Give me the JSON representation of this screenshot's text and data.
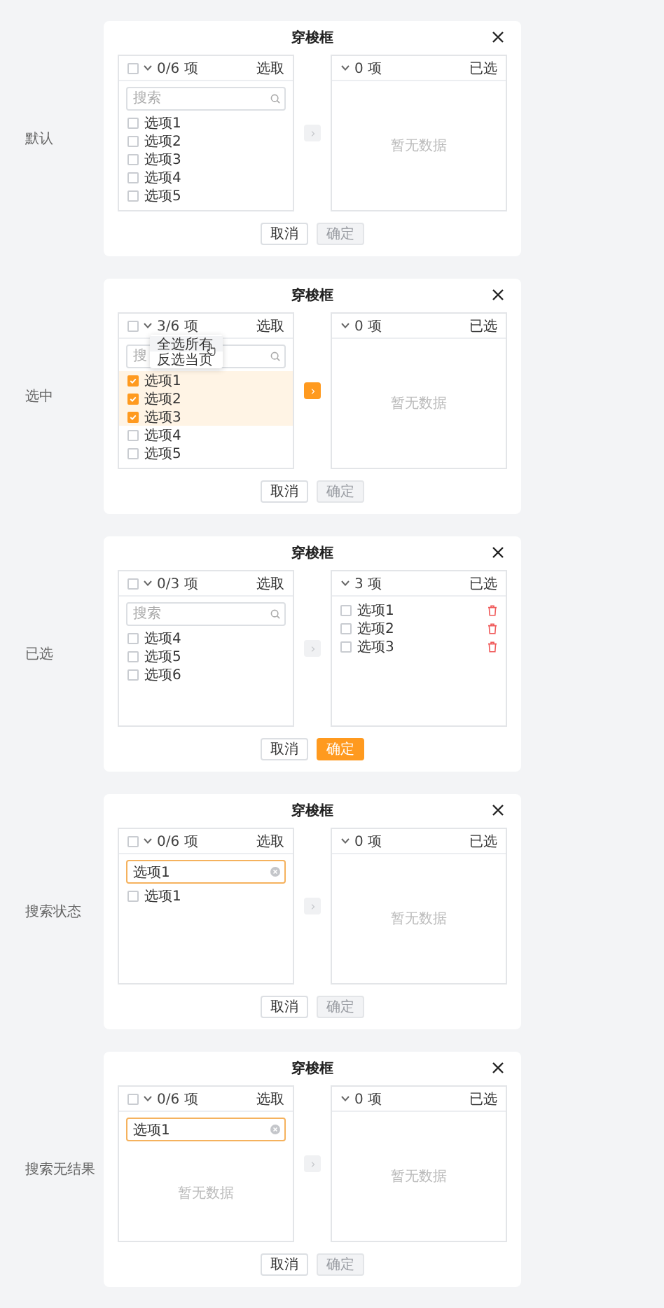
{
  "demos": [
    {
      "label": "默认",
      "title": "穿梭框",
      "left": {
        "checked": false,
        "count": "0/6 项",
        "label": "选取",
        "search": {
          "placeholder": "搜索",
          "focused": false
        },
        "items": [
          {
            "label": "选项1",
            "checked": false
          },
          {
            "label": "选项2",
            "checked": false
          },
          {
            "label": "选项3",
            "checked": false
          },
          {
            "label": "选项4",
            "checked": false
          },
          {
            "label": "选项5",
            "checked": false
          }
        ]
      },
      "transfer_active": false,
      "right": {
        "count": "0 项",
        "label": "已选",
        "empty_text": "暂无数据"
      },
      "buttons": [
        {
          "label": "取消",
          "kind": "default",
          "disabled": false
        },
        {
          "label": "确定",
          "kind": "primary",
          "disabled": true
        }
      ]
    },
    {
      "label": "选中",
      "title": "穿梭框",
      "left": {
        "checked": false,
        "count": "3/6 项",
        "label": "选取",
        "search": {
          "placeholder": "搜",
          "focused": false
        },
        "menu": [
          "全选所有",
          "反选当页"
        ],
        "items": [
          {
            "label": "选项1",
            "checked": true
          },
          {
            "label": "选项2",
            "checked": true
          },
          {
            "label": "选项3",
            "checked": true
          },
          {
            "label": "选项4",
            "checked": false
          },
          {
            "label": "选项5",
            "checked": false
          }
        ]
      },
      "transfer_active": true,
      "right": {
        "count": "0 项",
        "label": "已选",
        "empty_text": "暂无数据"
      },
      "buttons": [
        {
          "label": "取消",
          "kind": "default",
          "disabled": false
        },
        {
          "label": "确定",
          "kind": "primary",
          "disabled": true
        }
      ]
    },
    {
      "label": "已选",
      "title": "穿梭框",
      "left": {
        "checked": false,
        "count": "0/3 项",
        "label": "选取",
        "search": {
          "placeholder": "搜索",
          "focused": false
        },
        "items": [
          {
            "label": "选项4",
            "checked": false
          },
          {
            "label": "选项5",
            "checked": false
          },
          {
            "label": "选项6",
            "checked": false
          }
        ]
      },
      "transfer_active": false,
      "right": {
        "count": "3 项",
        "label": "已选",
        "items": [
          {
            "label": "选项1",
            "checked": false
          },
          {
            "label": "选项2",
            "checked": false
          },
          {
            "label": "选项3",
            "checked": false
          }
        ]
      },
      "buttons": [
        {
          "label": "取消",
          "kind": "default",
          "disabled": false
        },
        {
          "label": "确定",
          "kind": "primary",
          "disabled": false
        }
      ]
    },
    {
      "label": "搜索状态",
      "title": "穿梭框",
      "left": {
        "checked": false,
        "count": "0/6 项",
        "label": "选取",
        "search": {
          "value": "选项1",
          "focused": true
        },
        "items": [
          {
            "label": "选项1",
            "checked": false
          }
        ]
      },
      "transfer_active": false,
      "right": {
        "count": "0 项",
        "label": "已选",
        "empty_text": "暂无数据"
      },
      "buttons": [
        {
          "label": "取消",
          "kind": "default",
          "disabled": false
        },
        {
          "label": "确定",
          "kind": "primary",
          "disabled": true
        }
      ]
    },
    {
      "label": "搜索无结果",
      "title": "穿梭框",
      "left": {
        "checked": false,
        "count": "0/6 项",
        "label": "选取",
        "search": {
          "value": "选项1",
          "focused": true
        },
        "empty_text": "暂无数据"
      },
      "transfer_active": false,
      "right": {
        "count": "0 项",
        "label": "已选",
        "empty_text": "暂无数据"
      },
      "buttons": [
        {
          "label": "取消",
          "kind": "default",
          "disabled": false
        },
        {
          "label": "确定",
          "kind": "primary",
          "disabled": true
        }
      ]
    }
  ]
}
